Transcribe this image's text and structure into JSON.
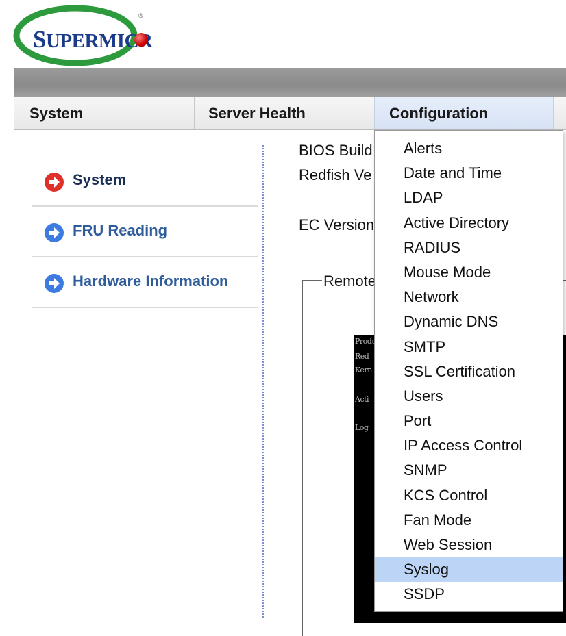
{
  "brand": {
    "name_big1": "S",
    "name_rest": "UPERMICR",
    "registered": "®"
  },
  "menubar": {
    "items": [
      "System",
      "Server Health",
      "Configuration"
    ]
  },
  "sidebar": {
    "items": [
      {
        "label": "System",
        "active": true
      },
      {
        "label": "FRU Reading",
        "active": false
      },
      {
        "label": "Hardware Information",
        "active": false
      }
    ]
  },
  "main": {
    "bios_label": "BIOS Build",
    "redfish_label": "Redfish Ve",
    "ec_label": "EC Version",
    "remote_label": "Remote",
    "console_lines": [
      "Produ",
      "Red",
      "Kern",
      "Acti",
      "Log"
    ]
  },
  "dropdown": {
    "items": [
      "Alerts",
      "Date and Time",
      "LDAP",
      "Active Directory",
      "RADIUS",
      "Mouse Mode",
      "Network",
      "Dynamic DNS",
      "SMTP",
      "SSL Certification",
      "Users",
      "Port",
      "IP Access Control",
      "SNMP",
      "KCS Control",
      "Fan Mode",
      "Web Session",
      "Syslog",
      "SSDP"
    ],
    "highlighted": "Syslog"
  },
  "colors": {
    "active_arrow": "#e0302a",
    "inactive_arrow": "#3d7be0",
    "highlight": "#bcd5f6",
    "logo_green": "#2e9a3e",
    "logo_blue": "#1b3a8a"
  }
}
